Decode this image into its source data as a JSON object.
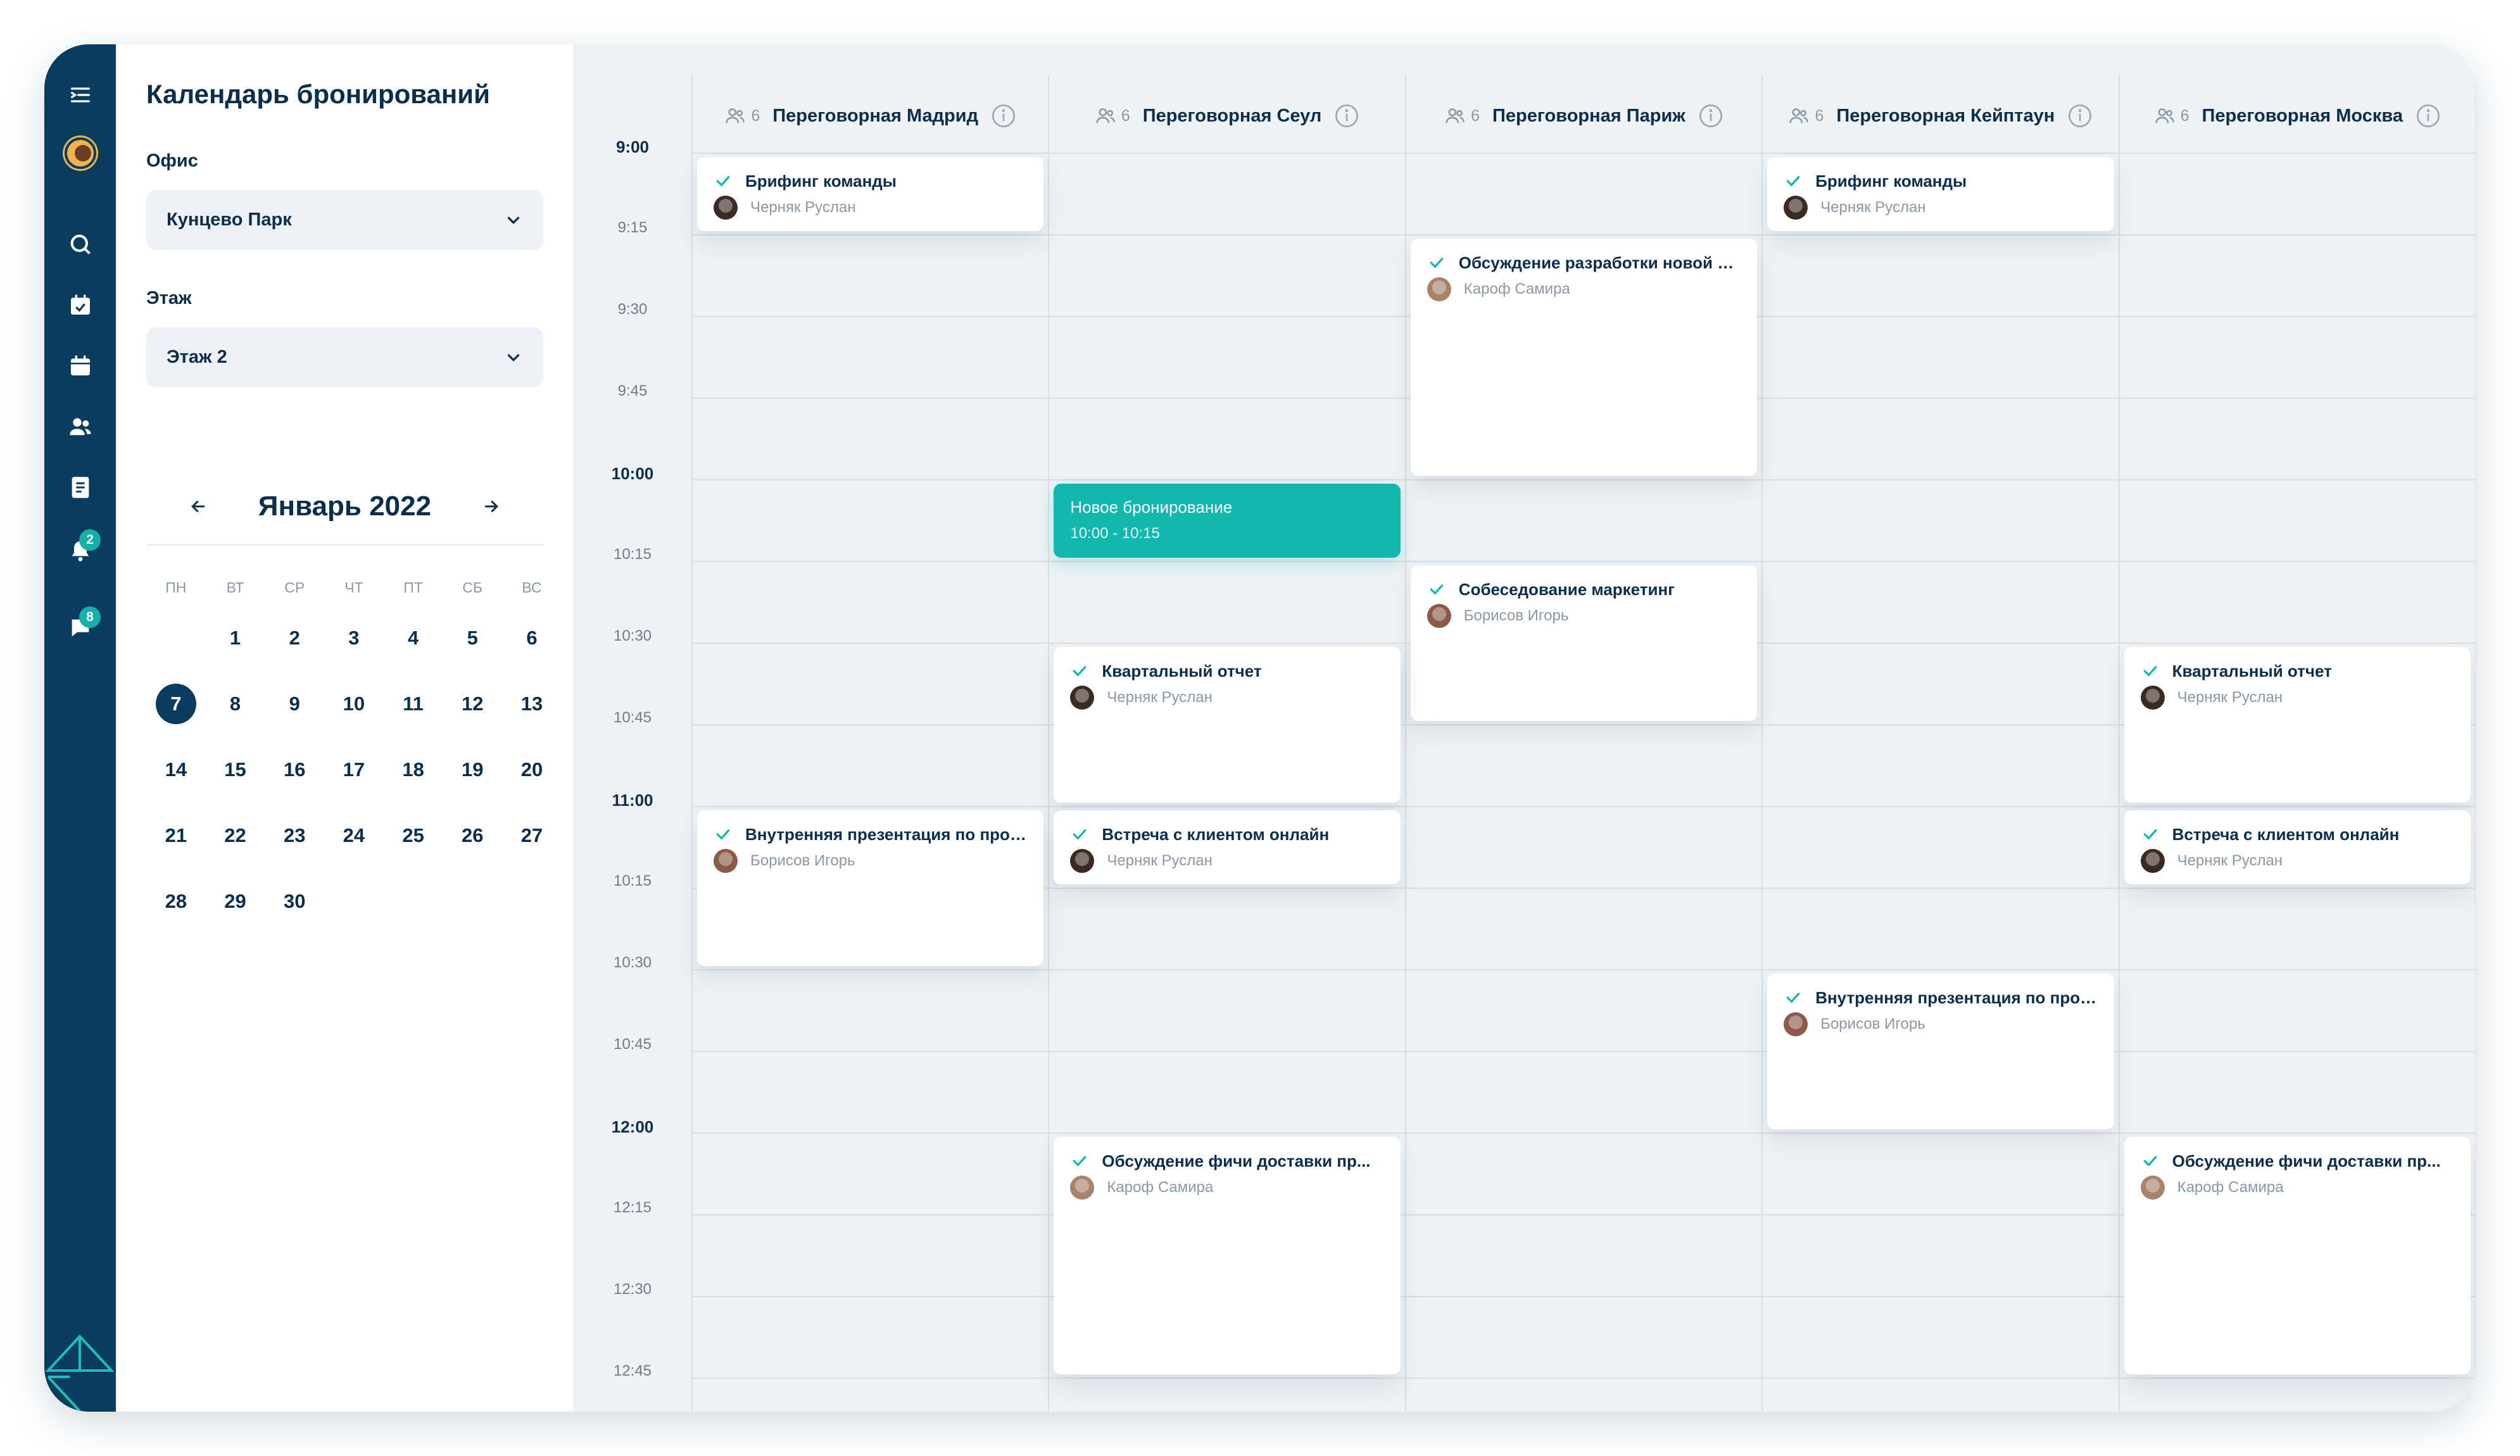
{
  "app": {
    "title": "Календарь бронирований"
  },
  "nav": {
    "badges": {
      "notifications": "2",
      "messages": "8"
    },
    "icons": [
      "menu-icon",
      "user-avatar",
      "search-icon",
      "calendar-check-icon",
      "calendar-icon",
      "users-icon",
      "document-icon",
      "bell-icon",
      "chat-icon"
    ]
  },
  "filters": {
    "office": {
      "label": "Офис",
      "value": "Кунцево Парк"
    },
    "floor": {
      "label": "Этаж",
      "value": "Этаж 2"
    }
  },
  "calendar": {
    "month_title": "Январь 2022",
    "weekdays": [
      "ПН",
      "ВТ",
      "СР",
      "ЧТ",
      "ПТ",
      "СБ",
      "ВС"
    ],
    "days": [
      "",
      "1",
      "2",
      "3",
      "4",
      "5",
      "6",
      "7",
      "8",
      "9",
      "10",
      "11",
      "12",
      "13",
      "14",
      "15",
      "16",
      "17",
      "18",
      "19",
      "20",
      "21",
      "22",
      "23",
      "24",
      "25",
      "26",
      "27",
      "28",
      "29",
      "30"
    ],
    "selected_day": "7",
    "accent": "#0a3c5f"
  },
  "schedule": {
    "time_labels": [
      "9:00",
      "9:15",
      "9:30",
      "9:45",
      "10:00",
      "10:15",
      "10:30",
      "10:45",
      "11:00",
      "10:15",
      "10:30",
      "10:45",
      "12:00",
      "12:15",
      "12:30",
      "12:45"
    ],
    "rooms": [
      {
        "capacity": "6",
        "name": "Переговорная Мадрид"
      },
      {
        "capacity": "6",
        "name": "Переговорная Сеул"
      },
      {
        "capacity": "6",
        "name": "Переговорная Париж"
      },
      {
        "capacity": "6",
        "name": "Переговорная Кейптаун"
      },
      {
        "capacity": "6",
        "name": "Переговорная Москва"
      }
    ],
    "new_booking": {
      "title": "Новое бронирование",
      "time": "10:00 - 10:15",
      "color": "#14b7ad"
    },
    "events": [
      {
        "title": "Брифинг команды",
        "person": "Черняк Руслан"
      },
      {
        "title": "Брифинг команды",
        "person": "Черняк Руслан"
      },
      {
        "title": "Обсуждение разработки новой ф...",
        "person": "Кароф Самира"
      },
      {
        "title": "Собеседование маркетинг",
        "person": "Борисов Игорь"
      },
      {
        "title": "Квартальный отчет",
        "person": "Черняк Руслан"
      },
      {
        "title": "Квартальный отчет",
        "person": "Черняк Руслан"
      },
      {
        "title": "Внутренняя презентация по прое...",
        "person": "Борисов Игорь"
      },
      {
        "title": "Встреча с клиентом онлайн",
        "person": "Черняк Руслан"
      },
      {
        "title": "Встреча с клиентом онлайн",
        "person": "Черняк Руслан"
      },
      {
        "title": "Внутренняя презентация по прое...",
        "person": "Борисов Игорь"
      },
      {
        "title": "Обсуждение фичи доставки пр...",
        "person": "Кароф Самира"
      },
      {
        "title": "Обсуждение фичи доставки пр...",
        "person": "Кароф Самира"
      }
    ]
  }
}
